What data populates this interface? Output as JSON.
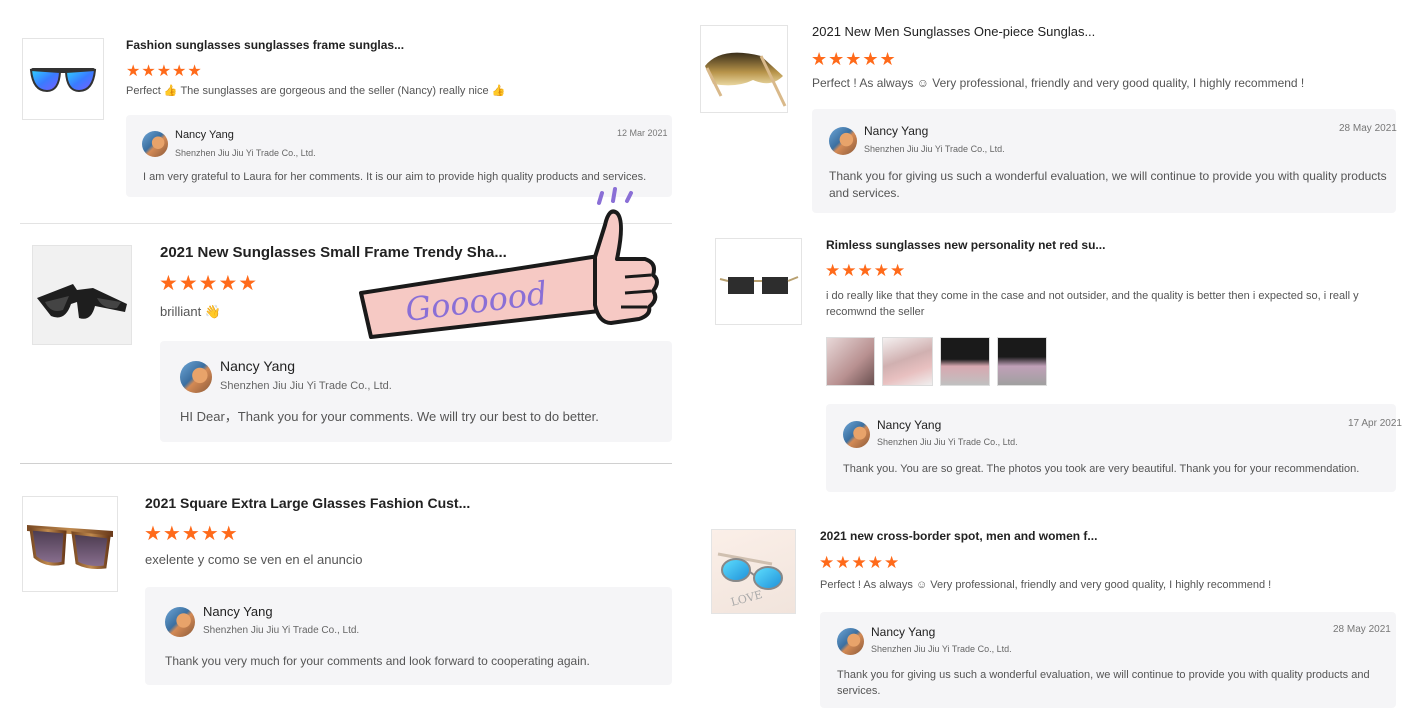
{
  "left": {
    "reviews": [
      {
        "title": "Fashion sunglasses sunglasses frame sunglas...",
        "stars": "★★★★★",
        "text": "Perfect 👍 The sunglasses are gorgeous and the seller (Nancy) really nice 👍",
        "reply": {
          "name": "Nancy Yang",
          "company": "Shenzhen Jiu Jiu Yi Trade Co., Ltd.",
          "date": "12 Mar 2021",
          "text": "I am very grateful to Laura for her comments. It is our aim to provide high quality products and services."
        }
      },
      {
        "title": "2021 New Sunglasses Small Frame Trendy Sha...",
        "stars": "★★★★★",
        "text": "brilliant 👋",
        "reply": {
          "name": "Nancy Yang",
          "company": "Shenzhen Jiu Jiu Yi Trade Co., Ltd.",
          "text": "HI Dear，Thank you for your comments. We will try our best to do better."
        }
      },
      {
        "title": "2021 Square Extra Large Glasses Fashion Cust...",
        "stars": "★★★★★",
        "text": "exelente y como se ven en el anuncio",
        "reply": {
          "name": "Nancy Yang",
          "company": "Shenzhen Jiu Jiu Yi Trade Co., Ltd.",
          "text": "Thank you very much for your comments and look forward to cooperating again."
        }
      }
    ]
  },
  "right": {
    "reviews": [
      {
        "title": "2021 New Men Sunglasses One-piece Sunglas...",
        "stars": "★★★★★",
        "text": "Perfect ! As always ☺ Very professional, friendly and very good quality, I highly recommend !",
        "reply": {
          "name": "Nancy Yang",
          "company": "Shenzhen Jiu Jiu Yi Trade Co., Ltd.",
          "date": "28 May 2021",
          "text": "Thank you for giving us such a wonderful evaluation, we will continue to provide you with quality products and services."
        }
      },
      {
        "title": "Rimless sunglasses new personality net red su...",
        "stars": "★★★★★",
        "text": "i do really like that they come in the case and not outsider, and the quality is better then i expected so, i reall y recomwnd the seller",
        "reply": {
          "name": "Nancy Yang",
          "company": "Shenzhen Jiu Jiu Yi Trade Co., Ltd.",
          "date": "17 Apr 2021",
          "text": "Thank you. You are so great. The photos you took are very beautiful. Thank you for your recommendation."
        }
      },
      {
        "title": "2021 new cross-border spot, men and women f...",
        "stars": "★★★★★",
        "text": "Perfect ! As always ☺ Very professional, friendly and very good quality, I highly recommend !",
        "reply": {
          "name": "Nancy Yang",
          "company": "Shenzhen Jiu Jiu Yi Trade Co., Ltd.",
          "date": "28 May 2021",
          "text": "Thank you for giving us such a wonderful evaluation, we will continue to provide you with quality products and services."
        }
      }
    ]
  },
  "sticker": {
    "text": "Goooood"
  },
  "colors": {
    "star": "#ff6a1a",
    "reply_bg": "#f5f5f7",
    "sticker_band": "#f6c9c4",
    "sticker_text": "#8a6fd6"
  }
}
